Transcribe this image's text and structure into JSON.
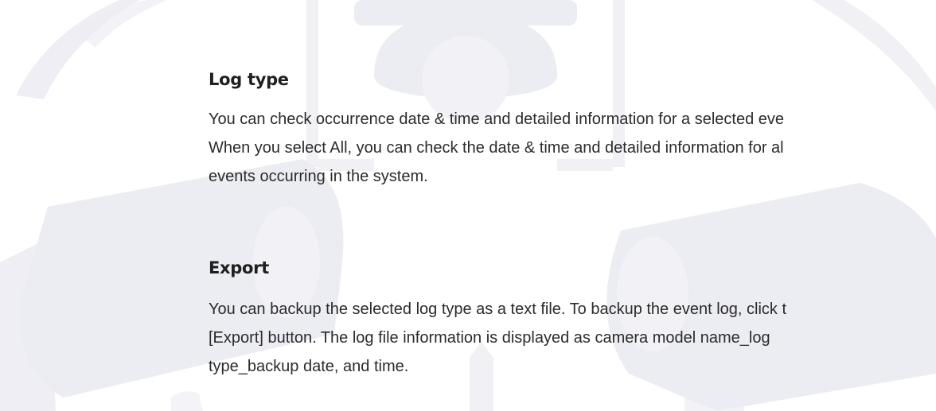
{
  "sections": [
    {
      "title": "Log type",
      "lines": [
        "You can check occurrence date & time and detailed information for a selected eve",
        "When you select All, you can check the date & time and detailed information for al",
        "events occurring in the system."
      ]
    },
    {
      "title": "Export",
      "lines": [
        "You can backup the selected log type as a text file. To backup the event log, click t",
        "[Export] button. The log file information is displayed as camera model name_log",
        "type_backup date, and time."
      ]
    }
  ],
  "watermark": {
    "description_icon": "cctv-camera-watermark-icon",
    "color": "#e9e9f2"
  },
  "colors": {
    "heading": "#1f1f1f",
    "body_text": "#2b2b2b",
    "watermark": "#e9e9f2"
  }
}
